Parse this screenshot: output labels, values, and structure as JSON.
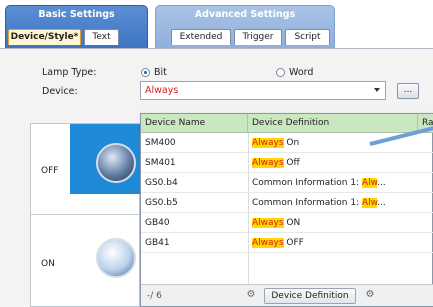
{
  "tabs": {
    "basic": {
      "title": "Basic Settings",
      "subtabs": [
        "Device/Style*",
        "Text"
      ]
    },
    "advanced": {
      "title": "Advanced Settings",
      "subtabs": [
        "Extended",
        "Trigger",
        "Script"
      ]
    }
  },
  "form": {
    "lamp_type_label": "Lamp Type:",
    "lamp_type_options": [
      "Bit",
      "Word"
    ],
    "lamp_type_selected": "Bit",
    "device_label": "Device:",
    "device_value": "Always",
    "browse_label": "..."
  },
  "states": [
    "OFF",
    "ON"
  ],
  "device_list": {
    "headers": [
      "Device Name",
      "Device Definition",
      "Ra"
    ],
    "rows": [
      {
        "name": "SM400",
        "def_hl": "Always",
        "def_rest": " On"
      },
      {
        "name": "SM401",
        "def_hl": "Always",
        "def_rest": " Off"
      },
      {
        "name": "GS0.b4",
        "def_prefix": "Common Information 1: ",
        "def_hl": "Alw",
        "def_rest": "..."
      },
      {
        "name": "GS0.b5",
        "def_prefix": "Common Information 1: ",
        "def_hl": "Alw",
        "def_rest": "..."
      },
      {
        "name": "GB40",
        "def_hl": "Always",
        "def_rest": " ON"
      },
      {
        "name": "GB41",
        "def_hl": "Always",
        "def_rest": " OFF"
      }
    ],
    "footer_count": "-/ 6",
    "footer_button": "Device Definition"
  },
  "colors": {
    "accent_blue": "#3d74c3",
    "highlight": "#ffd800",
    "header_green": "#c9e7c1",
    "alert_red": "#d22020"
  },
  "icons": [
    "gear-icon",
    "dropdown-arrow-icon",
    "browse-icon"
  ]
}
